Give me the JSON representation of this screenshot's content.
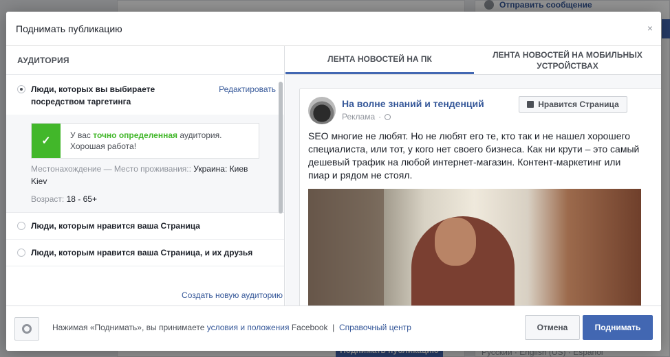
{
  "background": {
    "send_message": "Отправить сообщение",
    "langs": "Русский · English (US) · Español",
    "boost_button": "Поднимать публикацию"
  },
  "modal": {
    "title": "Поднимать публикацию",
    "close": "×"
  },
  "audience": {
    "section_title": "АУДИТОРИЯ",
    "options": [
      {
        "label": "Люди, которых вы выбираете посредством таргетинга",
        "selected": true
      },
      {
        "label": "Люди, которым нравится ваша Страница",
        "selected": false
      },
      {
        "label": "Люди, которым нравится ваша Страница, и их друзья",
        "selected": false
      }
    ],
    "edit_link": "Редактировать",
    "quality_prefix": "У вас ",
    "quality_highlight": "точно определенная",
    "quality_suffix": " аудитория.",
    "quality_line2": "Хорошая работа!",
    "location_label": "Местонахождение — Место проживания::",
    "location_value": "Украина: Киев",
    "location_value2": "Kiev",
    "age_label": "Возраст:",
    "age_value": "18 - 65+",
    "create_link": "Создать новую аудиторию"
  },
  "preview": {
    "tabs": [
      {
        "label": "ЛЕНТА НОВОСТЕЙ НА ПК",
        "active": true
      },
      {
        "label": "ЛЕНТА НОВОСТЕЙ НА МОБИЛЬНЫХ УСТРОЙСТВАХ",
        "active": false
      }
    ],
    "post": {
      "page_name": "На волне знаний и тенденций",
      "sponsored": "Реклама",
      "like_button": "Нравится Страница",
      "text": "SEO многие не любят. Но не любят его те, кто так и не нашел хорошего специалиста, или тот, у кого нет своего бизнеса. Как ни крути – это самый дешевый трафик на любой интернет-магазин. Контент-маркетинг или пиар и рядом не стоял."
    }
  },
  "footer": {
    "terms_prefix": "Нажимая «Поднимать», вы принимаете ",
    "terms_link": "условия и положения",
    "terms_brand": " Facebook  |  ",
    "help_link": "Справочный центр",
    "cancel": "Отмена",
    "boost": "Поднимать"
  },
  "colors": {
    "accent": "#4267b2",
    "link": "#365899",
    "success": "#42b72a"
  }
}
